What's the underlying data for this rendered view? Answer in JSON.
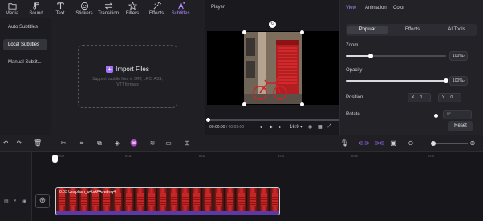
{
  "toolbar": {
    "items": [
      {
        "label": "Media",
        "icon": "folder-icon"
      },
      {
        "label": "Sound",
        "icon": "music-note-icon"
      },
      {
        "label": "Text",
        "icon": "text-icon"
      },
      {
        "label": "Stickers",
        "icon": "sticker-icon"
      },
      {
        "label": "Transition",
        "icon": "transition-icon"
      },
      {
        "label": "Filters",
        "icon": "filters-icon"
      },
      {
        "label": "Effects",
        "icon": "effects-icon"
      },
      {
        "label": "Subtitles",
        "icon": "subtitles-icon",
        "active": true
      }
    ]
  },
  "sidebar": {
    "items": [
      {
        "label": "Auto Subtitles"
      },
      {
        "label": "Local Subtitles",
        "active": true
      },
      {
        "label": "Manual Subtit..."
      }
    ]
  },
  "import": {
    "label": "Import Files",
    "hint": "Support subtitle files in SRT, LRC, ASS, VTT formats"
  },
  "player": {
    "title": "Player",
    "current_time": "00:00:00",
    "separator": " / ",
    "total_time": "00:03:00",
    "aspect": "16:9",
    "progress": 0.0
  },
  "properties": {
    "tabs": [
      "View",
      "Animation",
      "Color"
    ],
    "active_tab": "View",
    "subtabs": [
      "Popular",
      "Effects",
      "AI Tools"
    ],
    "active_subtab": "Popular",
    "zoom": {
      "label": "Zoom",
      "value": "100%",
      "fraction": 0.25
    },
    "opacity": {
      "label": "Opacity",
      "value": "100%",
      "fraction": 1.0
    },
    "position": {
      "label": "Position",
      "x_axis": "X",
      "x_value": "0",
      "y_axis": "Y",
      "y_value": "0"
    },
    "rotate": {
      "label": "Rotate",
      "value": "0°"
    },
    "reset_label": "Reset"
  },
  "timeline": {
    "ticks": [
      "00:00",
      "0:01",
      "0:02",
      "0:03",
      "0:04",
      "0:05"
    ],
    "clip_label": "0:03 Unsplash_u4bAFAdwbng4"
  },
  "colors": {
    "accent": "#a472ff",
    "panel": "#1f1f24",
    "clip_bar": "#5b3aa8"
  }
}
